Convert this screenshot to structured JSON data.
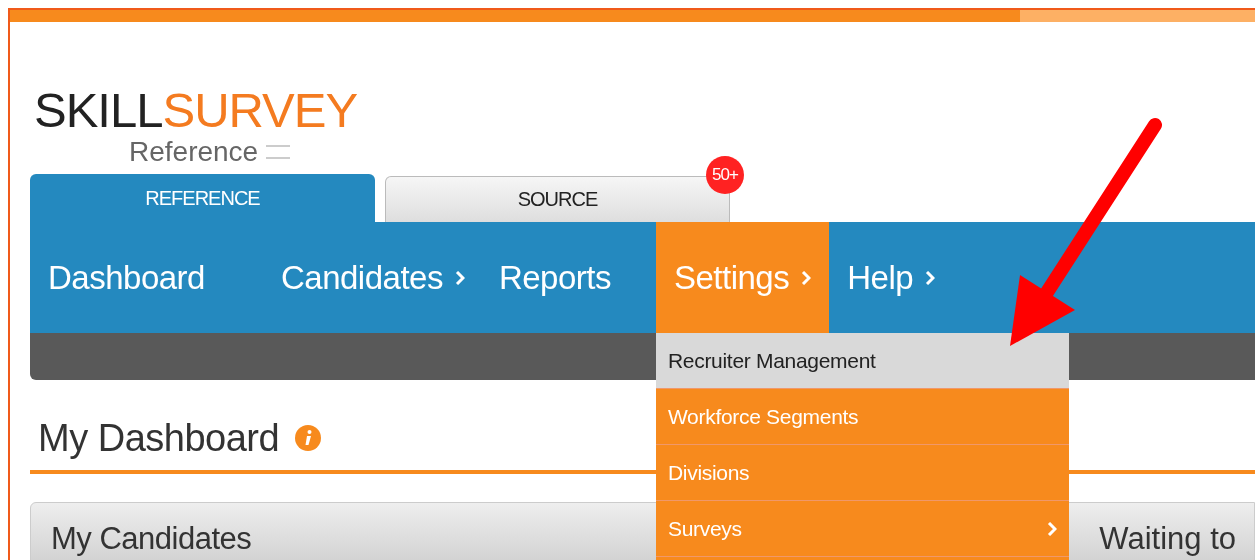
{
  "logo": {
    "dark": "SKILL",
    "accent": "SURVEY",
    "subtitle": "Reference"
  },
  "product_tabs": [
    {
      "label": "REFERENCE",
      "selected": true
    },
    {
      "label": "SOURCE",
      "selected": false,
      "badge": "50+"
    }
  ],
  "nav": [
    {
      "label": "Dashboard",
      "submenu": false,
      "selected": false
    },
    {
      "label": "Candidates",
      "submenu": true,
      "selected": false
    },
    {
      "label": "Reports",
      "submenu": false,
      "selected": false
    },
    {
      "label": "Settings",
      "submenu": true,
      "selected": true
    },
    {
      "label": "Help",
      "submenu": true,
      "selected": false
    }
  ],
  "settings_menu": [
    {
      "label": "Recruiter Management",
      "submenu": false,
      "selected": true
    },
    {
      "label": "Workforce Segments",
      "submenu": false,
      "selected": false
    },
    {
      "label": "Divisions",
      "submenu": false,
      "selected": false
    },
    {
      "label": "Surveys",
      "submenu": true,
      "selected": false
    }
  ],
  "page_title": "My Dashboard",
  "panel": {
    "title": "My Candidates",
    "column_2": "Waiting to"
  }
}
